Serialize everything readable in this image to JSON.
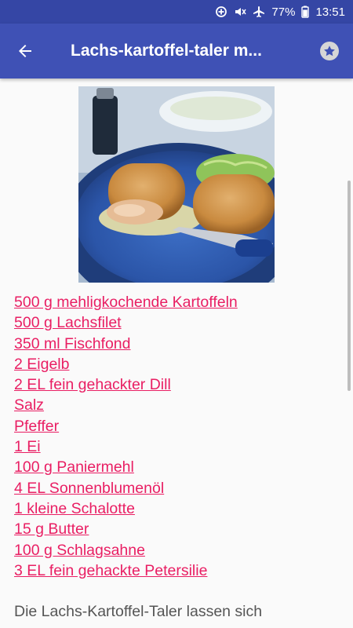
{
  "status": {
    "battery": "77%",
    "time": "13:51"
  },
  "appbar": {
    "title": "Lachs-kartoffel-taler m..."
  },
  "ingredients": [
    "500 g mehligkochende Kartoffeln",
    "500 g Lachsfilet",
    "350 ml Fischfond",
    "2 Eigelb",
    "2 EL fein gehackter Dill",
    "Salz",
    "Pfeffer",
    "1 Ei",
    "100 g Paniermehl",
    "4 EL Sonnenblumenöl",
    "1 kleine Schalotte",
    "15 g Butter",
    "100 g Schlagsahne",
    "3 EL fein gehackte Petersilie"
  ],
  "description": "Die Lachs-Kartoffel-Taler lassen sich"
}
